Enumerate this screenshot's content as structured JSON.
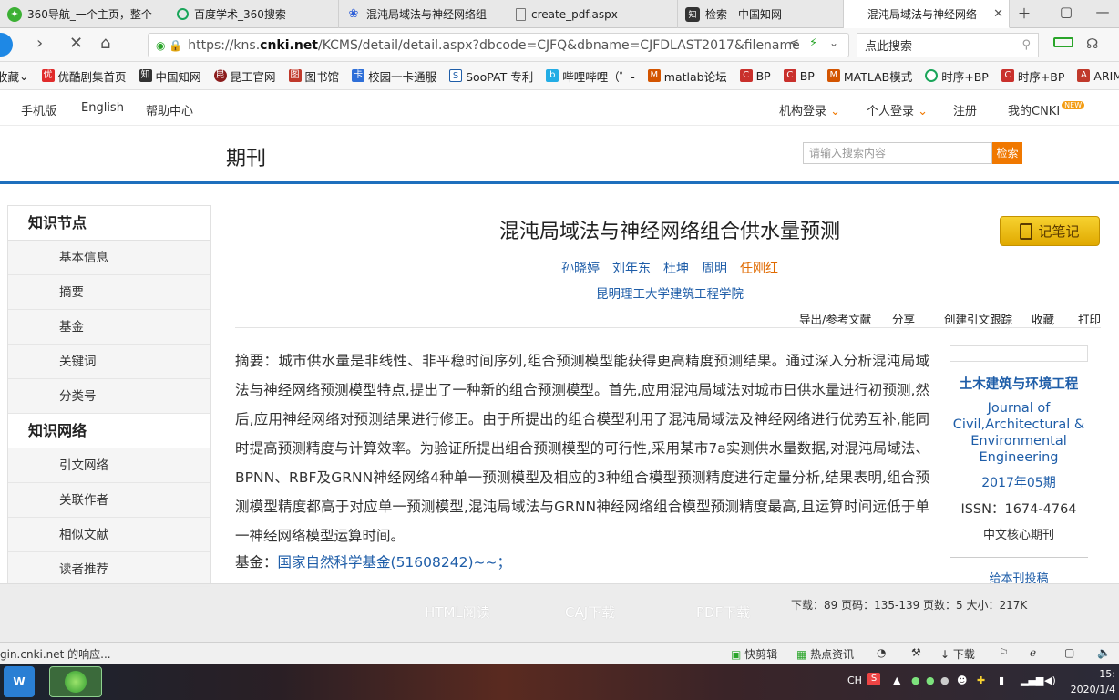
{
  "browser": {
    "tabs": [
      {
        "label": "360导航_一个主页，整个",
        "icon": "360-icon"
      },
      {
        "label": "百度学术_360搜索",
        "icon": "360search-icon"
      },
      {
        "label": "混沌局域法与神经网络组",
        "icon": "baidu-paw-icon"
      },
      {
        "label": "create_pdf.aspx",
        "icon": "document-icon"
      },
      {
        "label": "检索—中国知网",
        "icon": "cnki-icon"
      },
      {
        "label": "混沌局域法与神经网络",
        "icon": "cnki-icon",
        "active": true
      }
    ],
    "url_prefix": "https://kns.",
    "url_domain": "cnki.net",
    "url_rest": "/KCMS/detail/detail.aspx?dbcode=CJFQ&dbname=CJFDLAST2017&filename",
    "search_placeholder": "点此搜索",
    "bookmarks": [
      "收藏",
      "优酷剧集首页",
      "中国知网",
      "昆工官网",
      "图书馆",
      "校园一卡通服",
      "SooPAT 专利",
      "哔哩哔哩（゜-",
      "matlab论坛",
      "BP",
      "BP",
      "MATLAB模式",
      "时序+BP",
      "时序+BP",
      "ARIMA"
    ]
  },
  "site": {
    "top_left_links": [
      "手机版",
      "English",
      "帮助中心"
    ],
    "top_right_links": [
      "机构登录",
      "个人登录",
      "注册",
      "我的CNKI"
    ],
    "new_badge": "NEW",
    "section_label": "期刊",
    "search_placeholder": "请输入搜索内容",
    "search_button": "检索"
  },
  "sidebar": {
    "sections": [
      {
        "title": "知识节点",
        "items": [
          "基本信息",
          "摘要",
          "基金",
          "关键词",
          "分类号"
        ]
      },
      {
        "title": "知识网络",
        "items": [
          "引文网络",
          "关联作者",
          "相似文献",
          "读者推荐"
        ]
      }
    ]
  },
  "article": {
    "title": "混沌局域法与神经网络组合供水量预测",
    "note_button": "记笔记",
    "authors": [
      "孙晓婷",
      "刘年东",
      "杜坤",
      "周明",
      "任刚红"
    ],
    "affiliation": "昆明理工大学建筑工程学院",
    "actions": [
      "导出/参考文献",
      "分享",
      "创建引文跟踪",
      "收藏",
      "打印"
    ],
    "abstract": "摘要：城市供水量是非线性、非平稳时间序列,组合预测模型能获得更高精度预测结果。通过深入分析混沌局域法与神经网络预测模型特点,提出了一种新的组合预测模型。首先,应用混沌局域法对城市日供水量进行初预测,然后,应用神经网络对预测结果进行修正。由于所提出的组合模型利用了混沌局域法及神经网络进行优势互补,能同时提高预测精度与计算效率。为验证所提出组合预测模型的可行性,采用某市7a实测供水量数据,对混沌局域法、BPNN、RBF及GRNN神经网络4种单一预测模型及相应的3种组合模型预测精度进行定量分析,结果表明,组合预测模型精度都高于对应单一预测模型,混沌局域法与GRNN神经网络组合模型预测精度最高,且运算时间远低于单一神经网络模型运算时间。",
    "fund_label": "基金：",
    "fund_link": "国家自然科学基金(51608242)~~；"
  },
  "journal": {
    "name": "土木建筑与环境工程",
    "name_en": "Journal of Civil,Architectural & Environmental Engineering",
    "issue": "2017年05期",
    "issn": "ISSN：1674-4764",
    "core": "中文核心期刊",
    "submit": "给本刊投稿"
  },
  "download_bar": {
    "buttons": [
      "HTML阅读",
      "CAJ下载",
      "PDF下载"
    ],
    "stats": "下载：89  页码：135-139  页数：5  大小：217K"
  },
  "statusbar": {
    "text": "gin.cnki.net 的响应...",
    "items": [
      "快剪辑",
      "热点资讯",
      "下载"
    ]
  },
  "taskbar": {
    "ime": "CH",
    "clock_time": "15:",
    "clock_date": "2020/1/4"
  }
}
